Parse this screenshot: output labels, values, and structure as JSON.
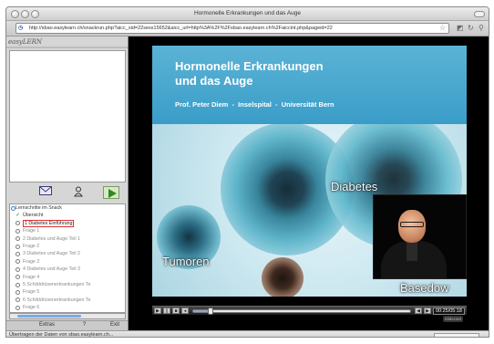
{
  "window": {
    "title": "Hormonelle Erkrankungen und das Auge"
  },
  "toolbar": {
    "url": "http://sbao.easylearn.ch/snackrun.php?aicc_sid=22sess15652&aicc_url=http%3A%2F%2Fsbao.easylearn.ch%2Faiccint.php&pageid=22"
  },
  "sidebar": {
    "logo": "easyLERN",
    "list_header": "Lernschritte im Snack",
    "items": [
      {
        "label": "Übersicht",
        "state": "done"
      },
      {
        "label": "1 Diabetes Einführung",
        "state": "active"
      },
      {
        "label": "Frage 1",
        "state": "open"
      },
      {
        "label": "2 Diabetes und Auge Teil 1",
        "state": "open"
      },
      {
        "label": "Frage 2",
        "state": "open"
      },
      {
        "label": "3 Diabetes und Auge Teil 2",
        "state": "open"
      },
      {
        "label": "Frage 3",
        "state": "open"
      },
      {
        "label": "4 Diabetes und Auge Teil 3",
        "state": "open"
      },
      {
        "label": "Frage 4",
        "state": "open"
      },
      {
        "label": "5 Schilddrüsenerkrankungen Te",
        "state": "open"
      },
      {
        "label": "Frage 5",
        "state": "open"
      },
      {
        "label": "6 Schilddrüsenerkrankungen Te",
        "state": "open"
      },
      {
        "label": "Frage 6",
        "state": "open"
      }
    ],
    "footer": {
      "extras": "Extras",
      "help": "?",
      "exit": "Exit"
    }
  },
  "slide": {
    "title_line1": "Hormonelle Erkrankungen",
    "title_line2": "und das Auge",
    "subtitle": "Prof. Peter Diem  -  Inselspital  -  Universität Bern",
    "label_diabetes": "Diabetes",
    "label_tumoren": "Tumoren",
    "label_basedow": "Basedow"
  },
  "player": {
    "time": "00:25/05:18",
    "progress_fraction": 0.08,
    "badge": "Slidecast"
  },
  "status": {
    "text": "Übertragen der Daten von sbao.easylearn.ch..."
  }
}
